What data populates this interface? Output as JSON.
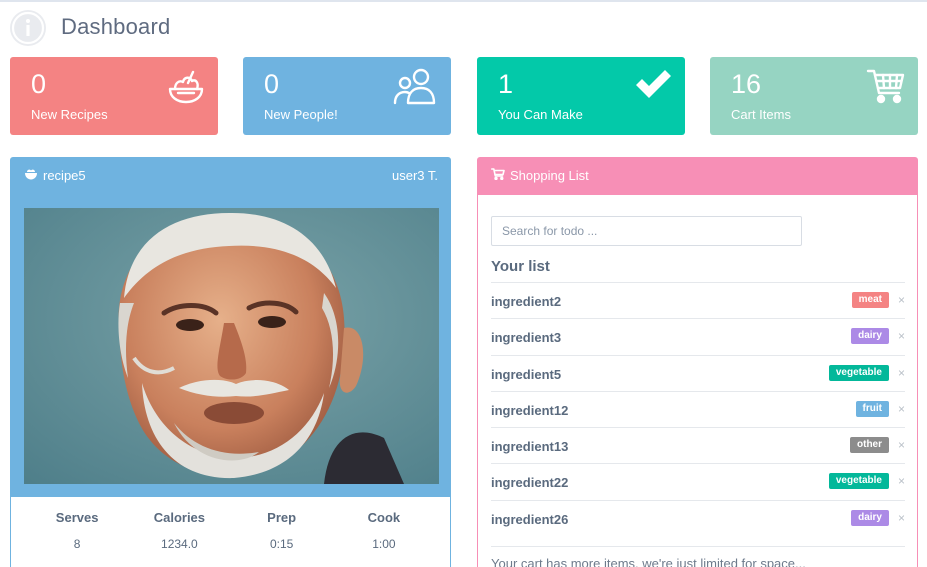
{
  "header": {
    "title": "Dashboard",
    "logo_icon": "info-circle-icon"
  },
  "stats": [
    {
      "value": "0",
      "label": "New Recipes",
      "icon": "salad-bowl-icon",
      "color": "#f48383"
    },
    {
      "value": "0",
      "label": "New People!",
      "icon": "users-icon",
      "color": "#6fb3e0"
    },
    {
      "value": "1",
      "label": "You Can Make",
      "icon": "checkmark-icon",
      "color": "#03c9a9"
    },
    {
      "value": "16",
      "label": "Cart Items",
      "icon": "shopping-cart-icon",
      "color": "#96d4c2"
    }
  ],
  "recipe_panel": {
    "title": "recipe5",
    "title_icon": "bowl-icon",
    "user": "user3 T.",
    "image_icon": "portrait-painting",
    "stats": [
      {
        "label": "Serves",
        "value": "8"
      },
      {
        "label": "Calories",
        "value": "1234.0"
      },
      {
        "label": "Prep",
        "value": "0:15"
      },
      {
        "label": "Cook",
        "value": "1:00"
      }
    ],
    "accent": "#6fb3e0"
  },
  "shopping_panel": {
    "title": "Shopping List",
    "title_icon": "shopping-cart-icon",
    "search_placeholder": "Search for todo ...",
    "list_heading": "Your list",
    "items": [
      {
        "name": "ingredient2",
        "tag": "meat",
        "tag_color": "#f48383"
      },
      {
        "name": "ingredient3",
        "tag": "dairy",
        "tag_color": "#ac8ae6"
      },
      {
        "name": "ingredient5",
        "tag": "vegetable",
        "tag_color": "#03b89a"
      },
      {
        "name": "ingredient12",
        "tag": "fruit",
        "tag_color": "#6fb3e0"
      },
      {
        "name": "ingredient13",
        "tag": "other",
        "tag_color": "#8c8c8c"
      },
      {
        "name": "ingredient22",
        "tag": "vegetable",
        "tag_color": "#03b89a"
      },
      {
        "name": "ingredient26",
        "tag": "dairy",
        "tag_color": "#ac8ae6"
      }
    ],
    "remove_glyph": "×",
    "footnote": "Your cart has more items, we're just limited for space...",
    "accent": "#f78fb6"
  }
}
